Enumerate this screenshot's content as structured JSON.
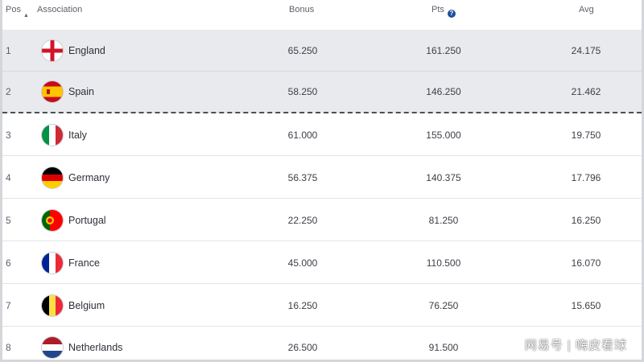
{
  "header": {
    "pos": "Pos",
    "association": "Association",
    "bonus": "Bonus",
    "pts": "Pts",
    "avg": "Avg",
    "info_glyph": "?"
  },
  "rows": [
    {
      "pos": "1",
      "name": "England",
      "bonus": "65.250",
      "pts": "161.250",
      "avg": "24.175",
      "flag": "flag-england-icon"
    },
    {
      "pos": "2",
      "name": "Spain",
      "bonus": "58.250",
      "pts": "146.250",
      "avg": "21.462",
      "flag": "flag-spain-icon"
    },
    {
      "pos": "3",
      "name": "Italy",
      "bonus": "61.000",
      "pts": "155.000",
      "avg": "19.750",
      "flag": "flag-italy-icon"
    },
    {
      "pos": "4",
      "name": "Germany",
      "bonus": "56.375",
      "pts": "140.375",
      "avg": "17.796",
      "flag": "flag-germany-icon"
    },
    {
      "pos": "5",
      "name": "Portugal",
      "bonus": "22.250",
      "pts": "81.250",
      "avg": "16.250",
      "flag": "flag-portugal-icon"
    },
    {
      "pos": "6",
      "name": "France",
      "bonus": "45.000",
      "pts": "110.500",
      "avg": "16.070",
      "flag": "flag-france-icon"
    },
    {
      "pos": "7",
      "name": "Belgium",
      "bonus": "16.250",
      "pts": "76.250",
      "avg": "15.650",
      "flag": "flag-belgium-icon"
    },
    {
      "pos": "8",
      "name": "Netherlands",
      "bonus": "26.500",
      "pts": "91.500",
      "avg": "",
      "flag": "flag-netherlands-icon"
    }
  ],
  "watermark": "网易号 | 嗨皮看球",
  "colors": {
    "highlight_row": "#e9eaed",
    "info_icon": "#1b4f9c",
    "text": "#3b3f46"
  }
}
